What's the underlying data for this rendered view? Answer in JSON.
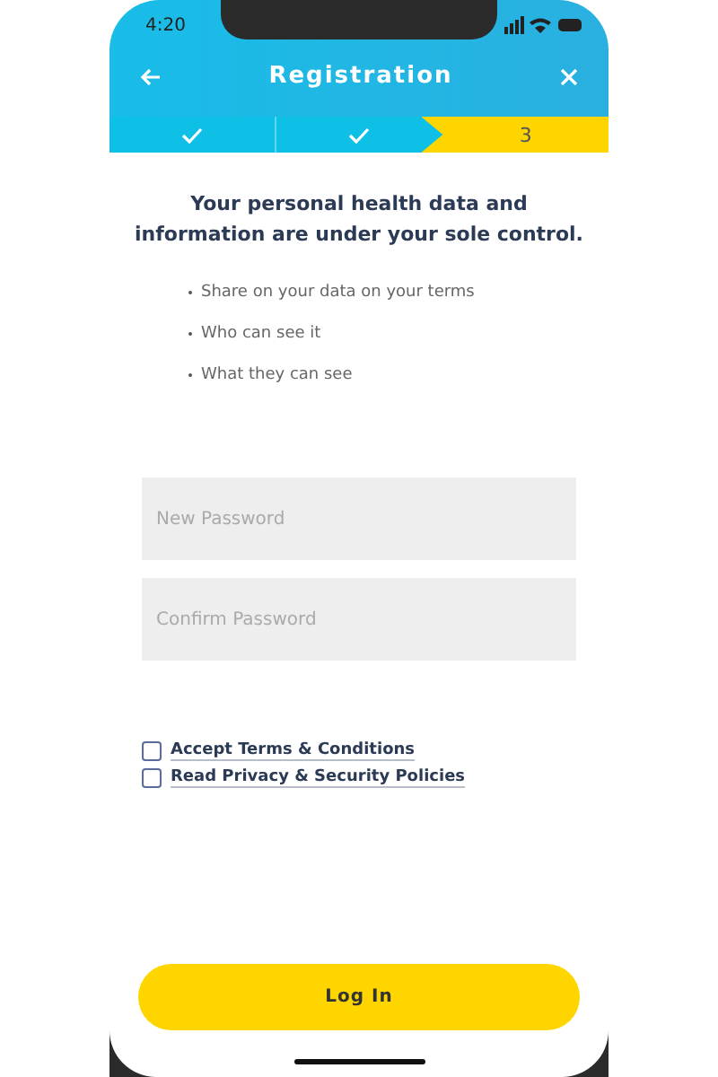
{
  "status_bar": {
    "time": "4:20"
  },
  "header": {
    "title": "Registration"
  },
  "steps": [
    {
      "completed": true,
      "selected": false
    },
    {
      "completed": true,
      "selected": false
    },
    {
      "completed": false,
      "selected": true,
      "label": "3"
    }
  ],
  "heading": "Your personal health data and information are under your sole control.",
  "bullets": [
    "Share on your data on your terms",
    "Who can see it",
    "What they can see"
  ],
  "fields": [
    {
      "placeholder": "New Password"
    },
    {
      "placeholder": "Confirm Password"
    }
  ],
  "agreements": [
    {
      "label": "Accept Terms & Conditions",
      "checked": false
    },
    {
      "label": "Read Privacy & Security Policies",
      "checked": false
    }
  ],
  "button": "Log In"
}
